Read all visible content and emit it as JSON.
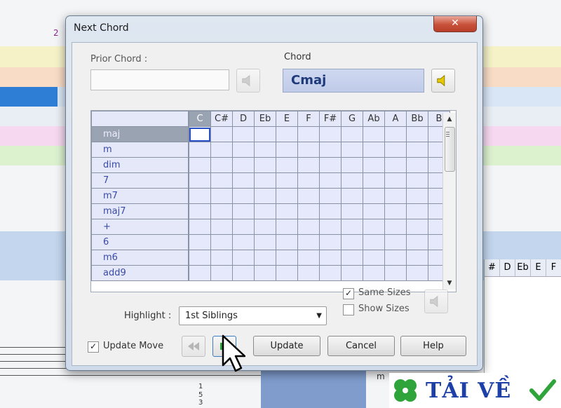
{
  "dialog": {
    "title": "Next Chord",
    "close_glyph": "✕"
  },
  "prior_chord": {
    "label": "Prior Chord :",
    "value": ""
  },
  "chord": {
    "label": "Chord",
    "value": "Cmaj"
  },
  "grid": {
    "columns": [
      "C",
      "C#",
      "D",
      "Eb",
      "E",
      "F",
      "F#",
      "G",
      "Ab",
      "A",
      "Bb",
      "B"
    ],
    "rows": [
      "maj",
      "m",
      "dim",
      "7",
      "m7",
      "maj7",
      "+",
      "6",
      "m6",
      "add9"
    ],
    "selected_row": "maj",
    "selected_column": "C"
  },
  "highlight": {
    "label": "Highlight :",
    "selected": "1st Siblings"
  },
  "options": {
    "same_sizes": {
      "label": "Same Sizes",
      "checked": true
    },
    "show_sizes": {
      "label": "Show Sizes",
      "checked": false
    },
    "update_move": {
      "label": "Update Move",
      "checked": true
    }
  },
  "buttons": {
    "update": "Update",
    "cancel": "Cancel",
    "help": "Help"
  },
  "background": {
    "measure_number": "2",
    "grid_columns": [
      "#",
      "D",
      "Eb",
      "E",
      "F"
    ],
    "side_label": "m",
    "staff_numbers": [
      "1",
      "5",
      "3"
    ]
  },
  "watermark": {
    "text": "TẢI VỀ"
  },
  "colors": {
    "speaker_active": "#e5c800",
    "chord_text": "#1f3a7a",
    "close_red": "#c8513a"
  }
}
